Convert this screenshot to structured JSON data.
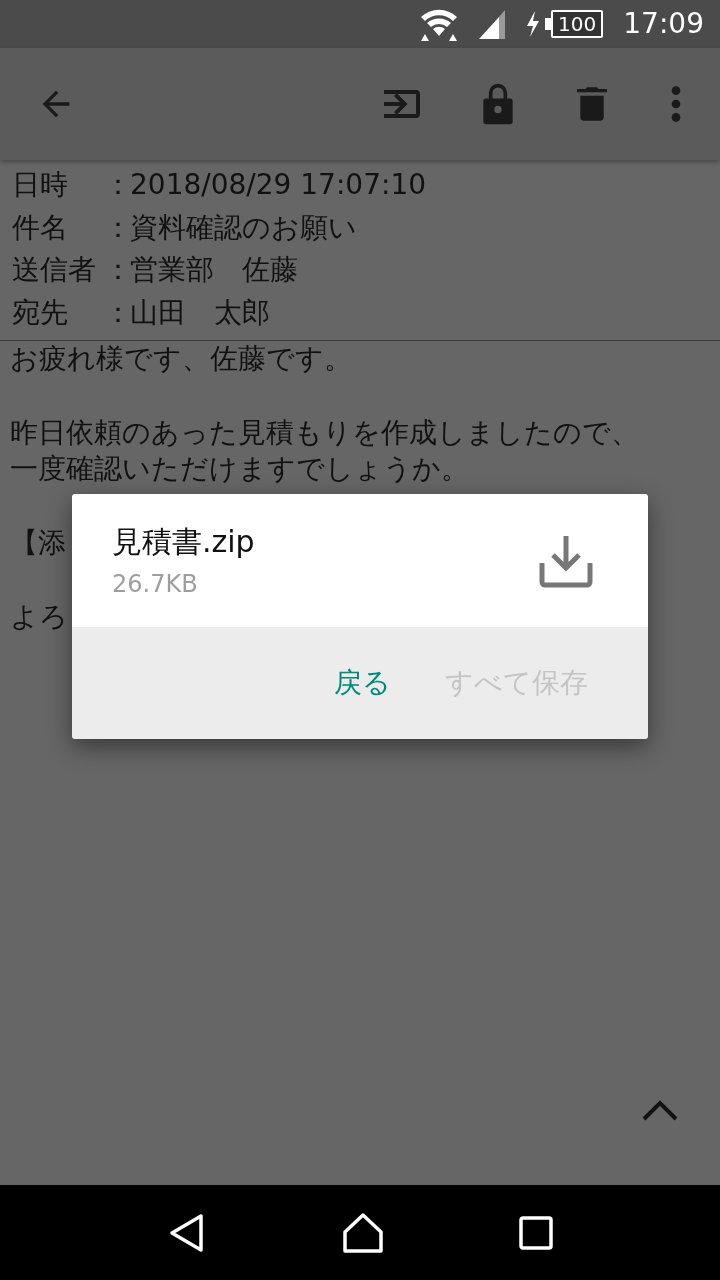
{
  "status_bar": {
    "battery": "100",
    "time": "17:09"
  },
  "headers": [
    {
      "label": "日時",
      "separator": "：",
      "value": "2018/08/29 17:07:10"
    },
    {
      "label": "件名",
      "separator": "：",
      "value": "資料確認のお願い"
    },
    {
      "label": "送信者",
      "separator": "：",
      "value": "営業部　佐藤"
    },
    {
      "label": "宛先",
      "separator": "：",
      "value": "山田　太郎"
    }
  ],
  "body": [
    [
      "お疲れ様です、佐藤です。"
    ],
    [
      "昨日依頼のあった見積もりを作成しましたので、",
      "一度確認いただけますでしょうか。"
    ],
    [
      "【添"
    ],
    [
      "よろ"
    ]
  ],
  "dialog": {
    "file_name": "見積書.zip",
    "file_size": "26.7KB",
    "buttons": [
      {
        "label": "戻る",
        "disabled": false
      },
      {
        "label": "すべて保存",
        "disabled": true
      }
    ]
  }
}
